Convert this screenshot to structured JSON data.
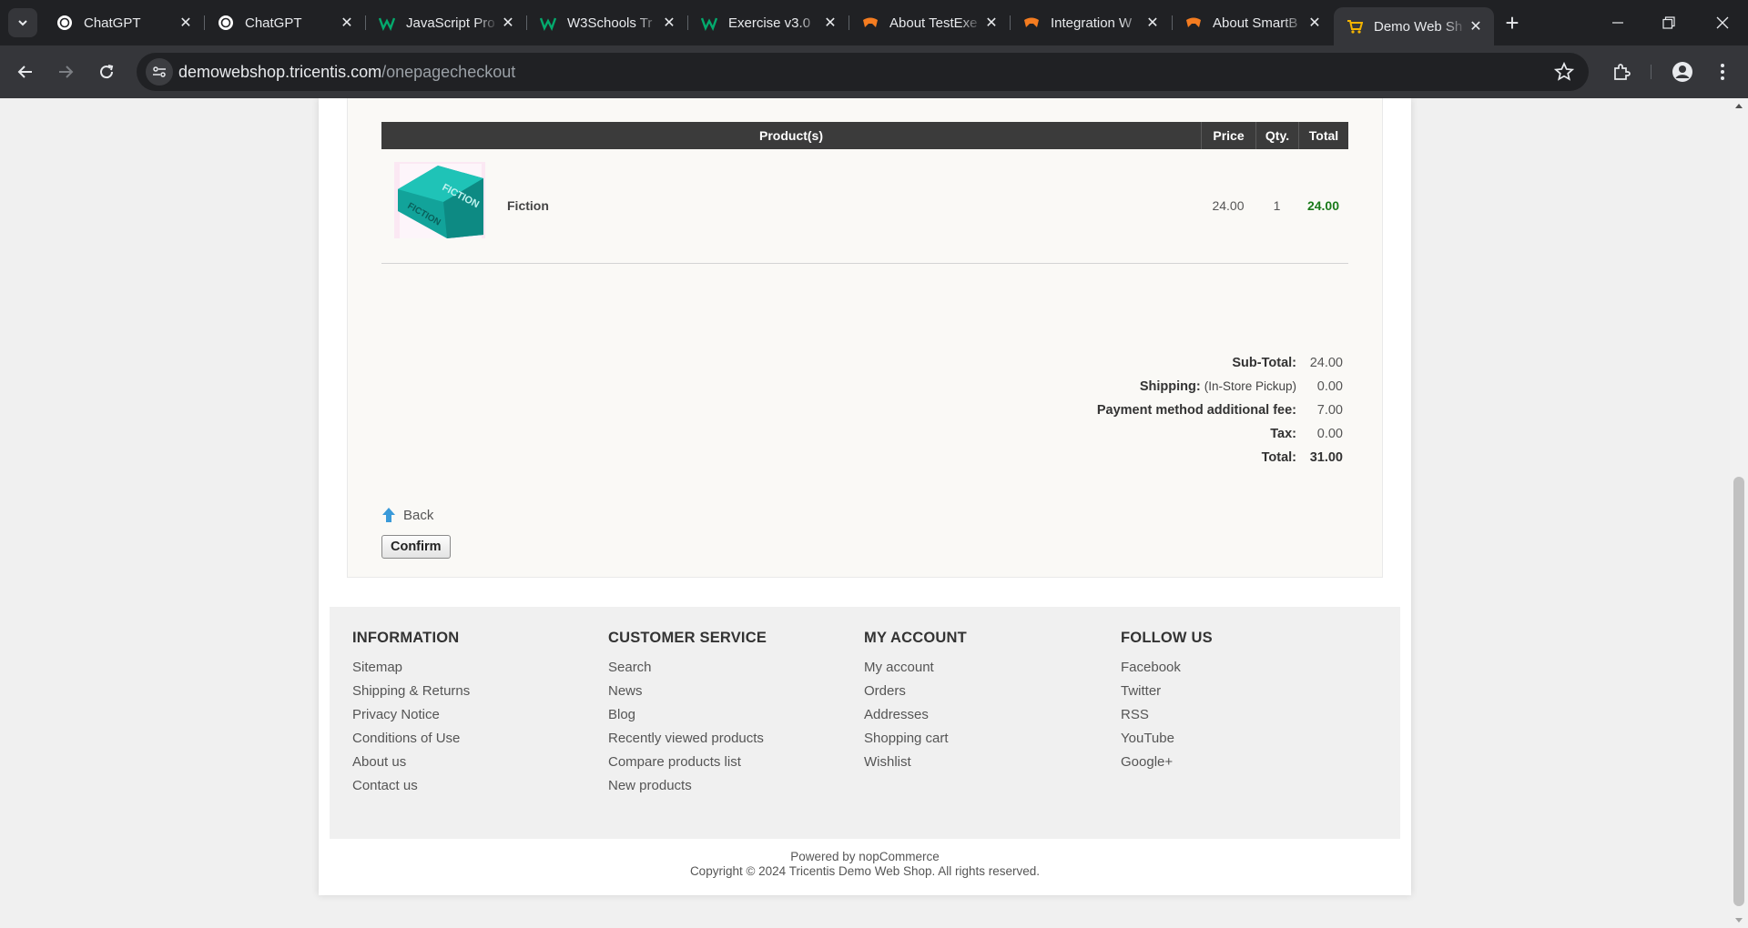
{
  "browser": {
    "tabs": [
      {
        "title": "ChatGPT",
        "icon": "chatgpt-icon"
      },
      {
        "title": "ChatGPT",
        "icon": "chatgpt-icon"
      },
      {
        "title": "JavaScript Pro",
        "icon": "w3schools-icon"
      },
      {
        "title": "W3Schools Tr",
        "icon": "w3schools-icon"
      },
      {
        "title": "Exercise v3.0",
        "icon": "w3schools-icon"
      },
      {
        "title": "About TestExe",
        "icon": "tricentis-icon"
      },
      {
        "title": "Integration W",
        "icon": "tricentis-icon"
      },
      {
        "title": "About SmartB",
        "icon": "tricentis-icon"
      },
      {
        "title": "Demo Web Sh",
        "icon": "cart-icon",
        "active": true
      }
    ],
    "url_host": "demowebshop.tricentis.com",
    "url_path": "/onepagecheckout"
  },
  "cart": {
    "headers": {
      "product": "Product(s)",
      "price": "Price",
      "qty": "Qty.",
      "total": "Total"
    },
    "items": [
      {
        "name": "Fiction",
        "price": "24.00",
        "qty": "1",
        "total": "24.00",
        "image_text": "FICTION"
      }
    ]
  },
  "totals": {
    "subtotal_label": "Sub-Total:",
    "subtotal": "24.00",
    "shipping_label": "Shipping:",
    "shipping_method": "(In-Store Pickup)",
    "shipping": "0.00",
    "payment_fee_label": "Payment method additional fee:",
    "payment_fee": "7.00",
    "tax_label": "Tax:",
    "tax": "0.00",
    "total_label": "Total:",
    "total": "31.00"
  },
  "actions": {
    "back": "Back",
    "confirm": "Confirm"
  },
  "footer": {
    "information": {
      "title": "INFORMATION",
      "links": [
        "Sitemap",
        "Shipping & Returns",
        "Privacy Notice",
        "Conditions of Use",
        "About us",
        "Contact us"
      ]
    },
    "customer_service": {
      "title": "CUSTOMER SERVICE",
      "links": [
        "Search",
        "News",
        "Blog",
        "Recently viewed products",
        "Compare products list",
        "New products"
      ]
    },
    "my_account": {
      "title": "MY ACCOUNT",
      "links": [
        "My account",
        "Orders",
        "Addresses",
        "Shopping cart",
        "Wishlist"
      ]
    },
    "follow_us": {
      "title": "FOLLOW US",
      "links": [
        "Facebook",
        "Twitter",
        "RSS",
        "YouTube",
        "Google+"
      ]
    },
    "powered_by": "Powered by nopCommerce",
    "copyright": "Copyright © 2024 Tricentis Demo Web Shop. All rights reserved."
  },
  "colors": {
    "accent_green": "#1a7a1a",
    "table_header": "#3b3b3b",
    "chrome_dark": "#202124",
    "chrome_mid": "#35363a"
  }
}
